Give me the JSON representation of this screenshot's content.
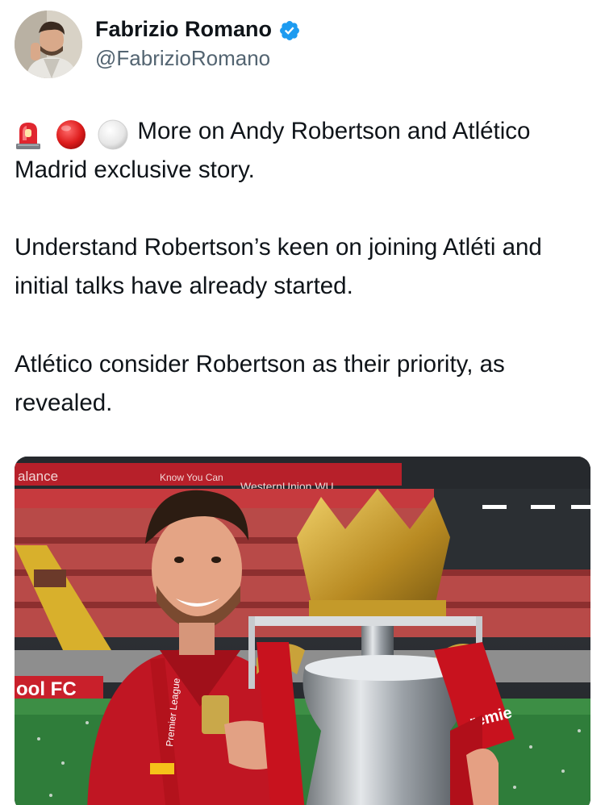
{
  "author": {
    "name": "Fabrizio Romano",
    "handle": "@FabrizioRomano",
    "verified_color": "#1d9bf0"
  },
  "tweet": {
    "emojis": [
      "police-light-icon",
      "red-circle-icon",
      "white-circle-icon"
    ],
    "line1": "More on Andy Robertson and Atlético Madrid exclusive story.",
    "line2": "Understand Robertson’s keen on joining Atléti and initial talks have already started.",
    "line3": "Atlético consider Robertson as their priority, as revealed."
  },
  "media": {
    "ad_boards": [
      "alance",
      "Know You Can",
      "WesternUnion WU"
    ],
    "sign_left": "ool FC",
    "trophy_ribbon": "Premier League",
    "ribbon_fragment": "remie"
  }
}
